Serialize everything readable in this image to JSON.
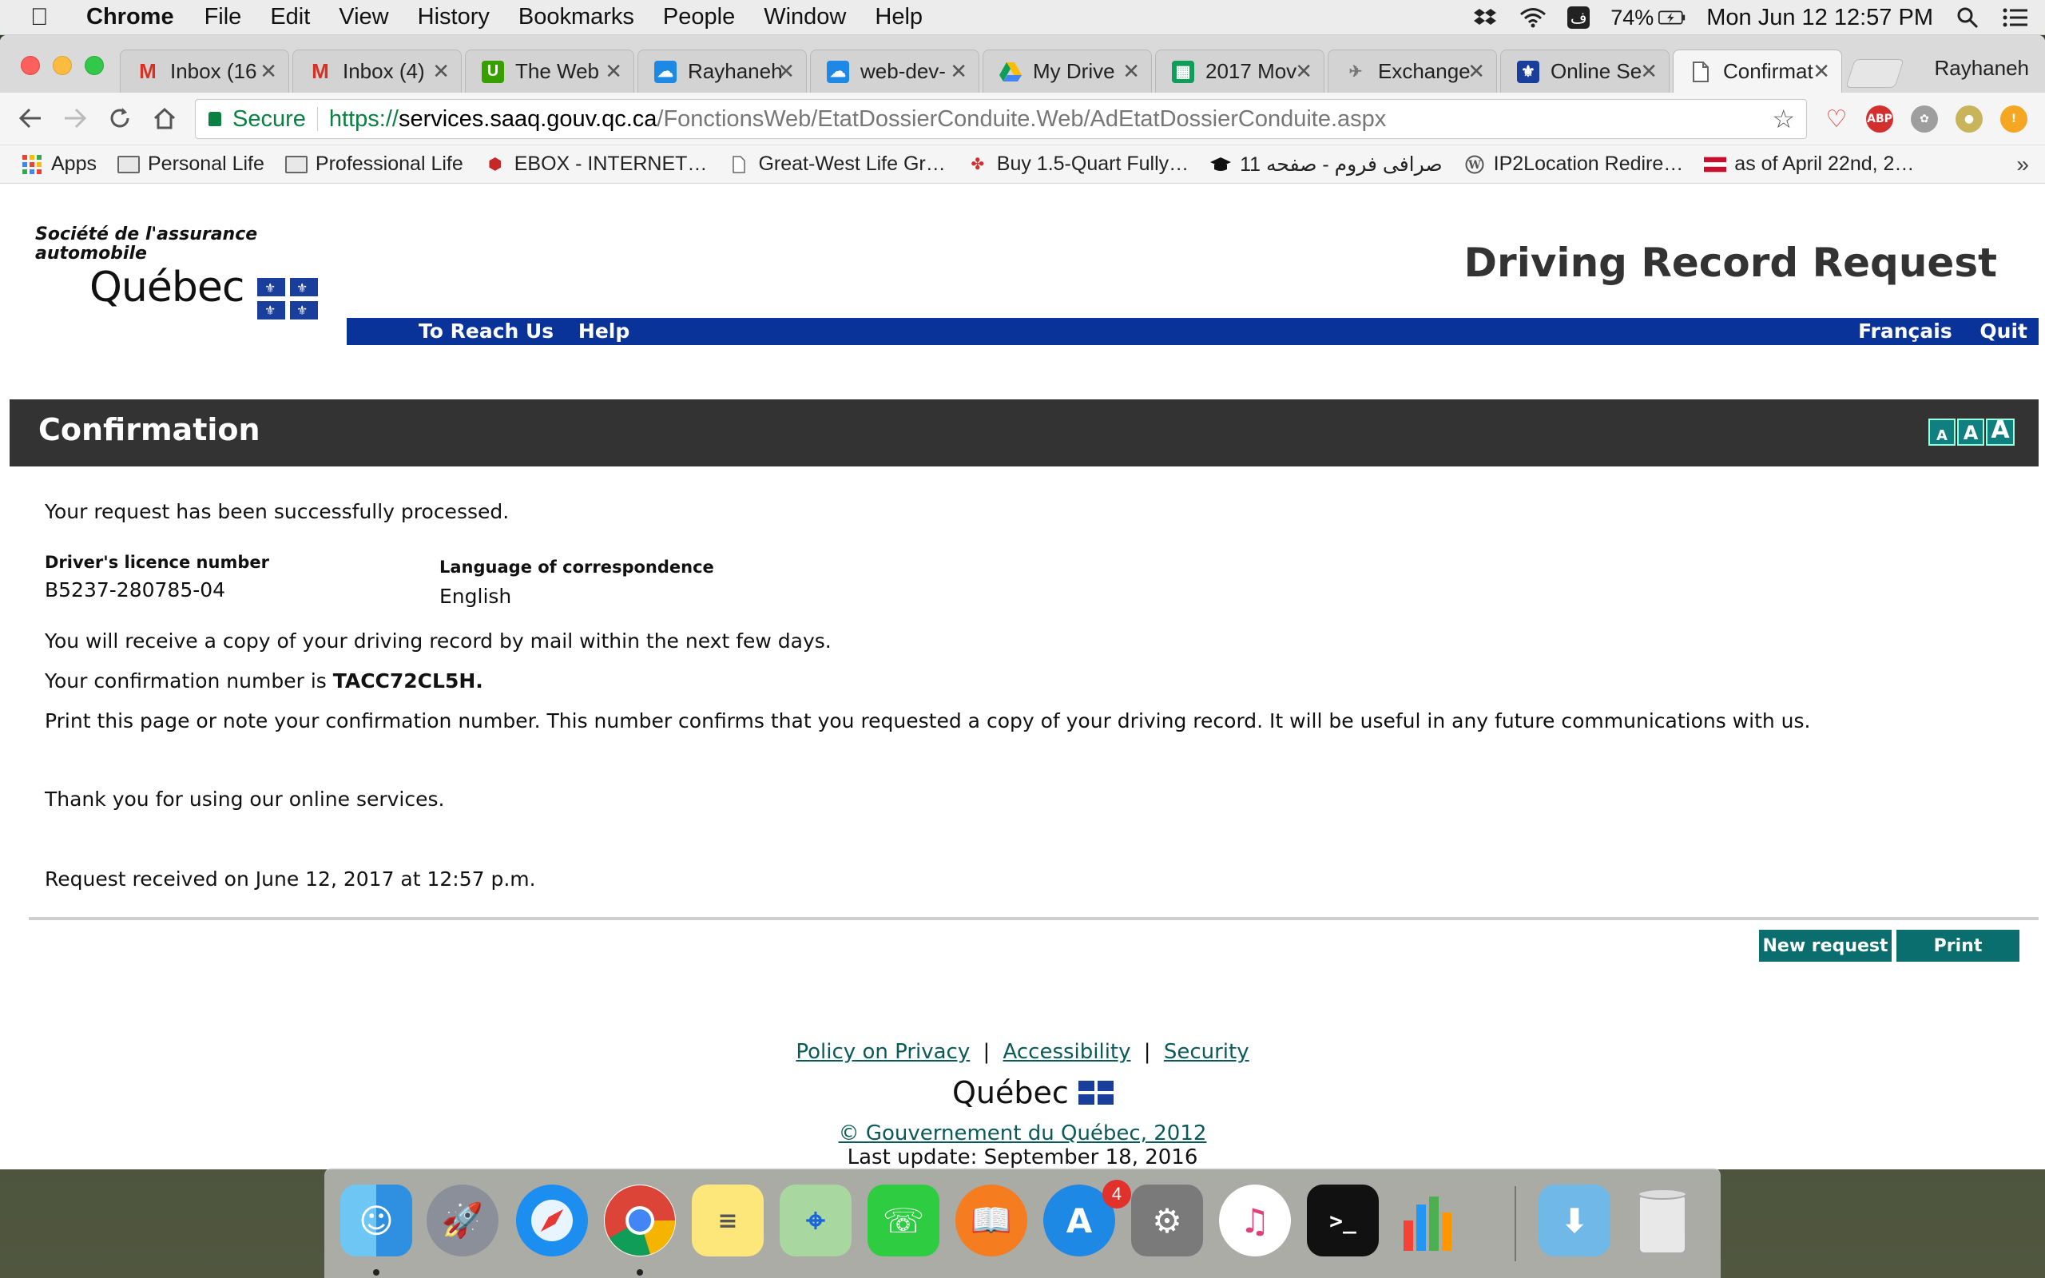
{
  "menubar": {
    "app": "Chrome",
    "menus": [
      "File",
      "Edit",
      "View",
      "History",
      "Bookmarks",
      "People",
      "Window",
      "Help"
    ],
    "input_source": "ف",
    "battery": "74%",
    "datetime": "Mon Jun 12  12:57 PM"
  },
  "tabs": [
    {
      "title": "Inbox (16",
      "icon": "gmail-icon"
    },
    {
      "title": "Inbox (4)",
      "icon": "gmail-icon"
    },
    {
      "title": "The Web",
      "icon": "upwork-icon"
    },
    {
      "title": "Rayhaneh",
      "icon": "cloud-icon"
    },
    {
      "title": "web-dev-",
      "icon": "cloud-icon"
    },
    {
      "title": "My Drive",
      "icon": "drive-icon"
    },
    {
      "title": "2017 Mov",
      "icon": "sheets-icon"
    },
    {
      "title": "Exchange",
      "icon": "exchange-icon"
    },
    {
      "title": "Online Se",
      "icon": "quebec-icon"
    },
    {
      "title": "Confirmat",
      "icon": "page-icon"
    }
  ],
  "profile_name": "Rayhaneh",
  "omnibox": {
    "secure_label": "Secure",
    "scheme": "https://",
    "host": "services.saaq.gouv.qc.ca",
    "path": "/FonctionsWeb/EtatDossierConduite.Web/AdEtatDossierConduite.aspx"
  },
  "bookmarks": [
    {
      "label": "Apps",
      "icon": "apps-grid-icon"
    },
    {
      "label": "Personal Life",
      "icon": "folder-icon"
    },
    {
      "label": "Professional Life",
      "icon": "folder-icon"
    },
    {
      "label": "EBOX - INTERNET…",
      "icon": "ebox-icon"
    },
    {
      "label": "Great-West Life Gr…",
      "icon": "page-icon"
    },
    {
      "label": "Buy 1.5-Quart Fully…",
      "icon": "maple-leaf-icon"
    },
    {
      "label": "صرافی فروم - صفحه 11",
      "icon": "graduation-cap-icon"
    },
    {
      "label": "IP2Location Redire…",
      "icon": "wordpress-icon"
    },
    {
      "label": "as of April 22nd, 2…",
      "icon": "flag-icon"
    }
  ],
  "page": {
    "logo_org_line1": "Société de l'assurance",
    "logo_org_line2": "automobile",
    "logo_quebec": "Québec",
    "app_title": "Driving Record Request",
    "nav_left": [
      "To Reach Us",
      "Help"
    ],
    "nav_right": [
      "Français",
      "Quit"
    ],
    "section_title": "Confirmation",
    "text_size_labels": [
      "A",
      "A",
      "A"
    ],
    "success_message": "Your request has been successfully processed.",
    "licence_label": "Driver's licence number",
    "licence_value": "B5237-280785-04",
    "language_label": "Language of correspondence",
    "language_value": "English",
    "mail_notice": "You will receive a copy of your driving record by mail within the next few days.",
    "confirmation_prefix": "Your confirmation number is ",
    "confirmation_number": "TACC72CL5H.",
    "print_notice": "Print this page or note your confirmation number. This number confirms that you requested a copy of your driving record. It will be useful in any future communications with us.",
    "thanks": "Thank you for using our online services.",
    "received": "Request received on June 12, 2017 at 12:57 p.m.",
    "buttons": {
      "new_request": "New request",
      "print": "Print"
    },
    "footer": {
      "privacy": "Policy on Privacy",
      "accessibility": "Accessibility",
      "security": "Security",
      "separator": "|",
      "quebec": "Québec",
      "copyright": "© Gouvernement du Québec, 2012",
      "last_update": "Last update: September 18, 2016"
    }
  },
  "dock": {
    "appstore_badge": "4",
    "apps": [
      "finder-icon",
      "launchpad-icon",
      "safari-icon",
      "chrome-icon",
      "notes-icon",
      "maps-icon",
      "facetime-icon",
      "ibooks-icon",
      "appstore-icon",
      "system-preferences-icon",
      "itunes-icon",
      "terminal-icon",
      "numbers-icon",
      "downloads-folder-icon",
      "trash-icon"
    ]
  },
  "colors": {
    "page_blue_bar": "#0a3399",
    "confirmation_bar": "#333333",
    "button_teal": "#0a6e6e",
    "secure_green": "#0b8043"
  }
}
